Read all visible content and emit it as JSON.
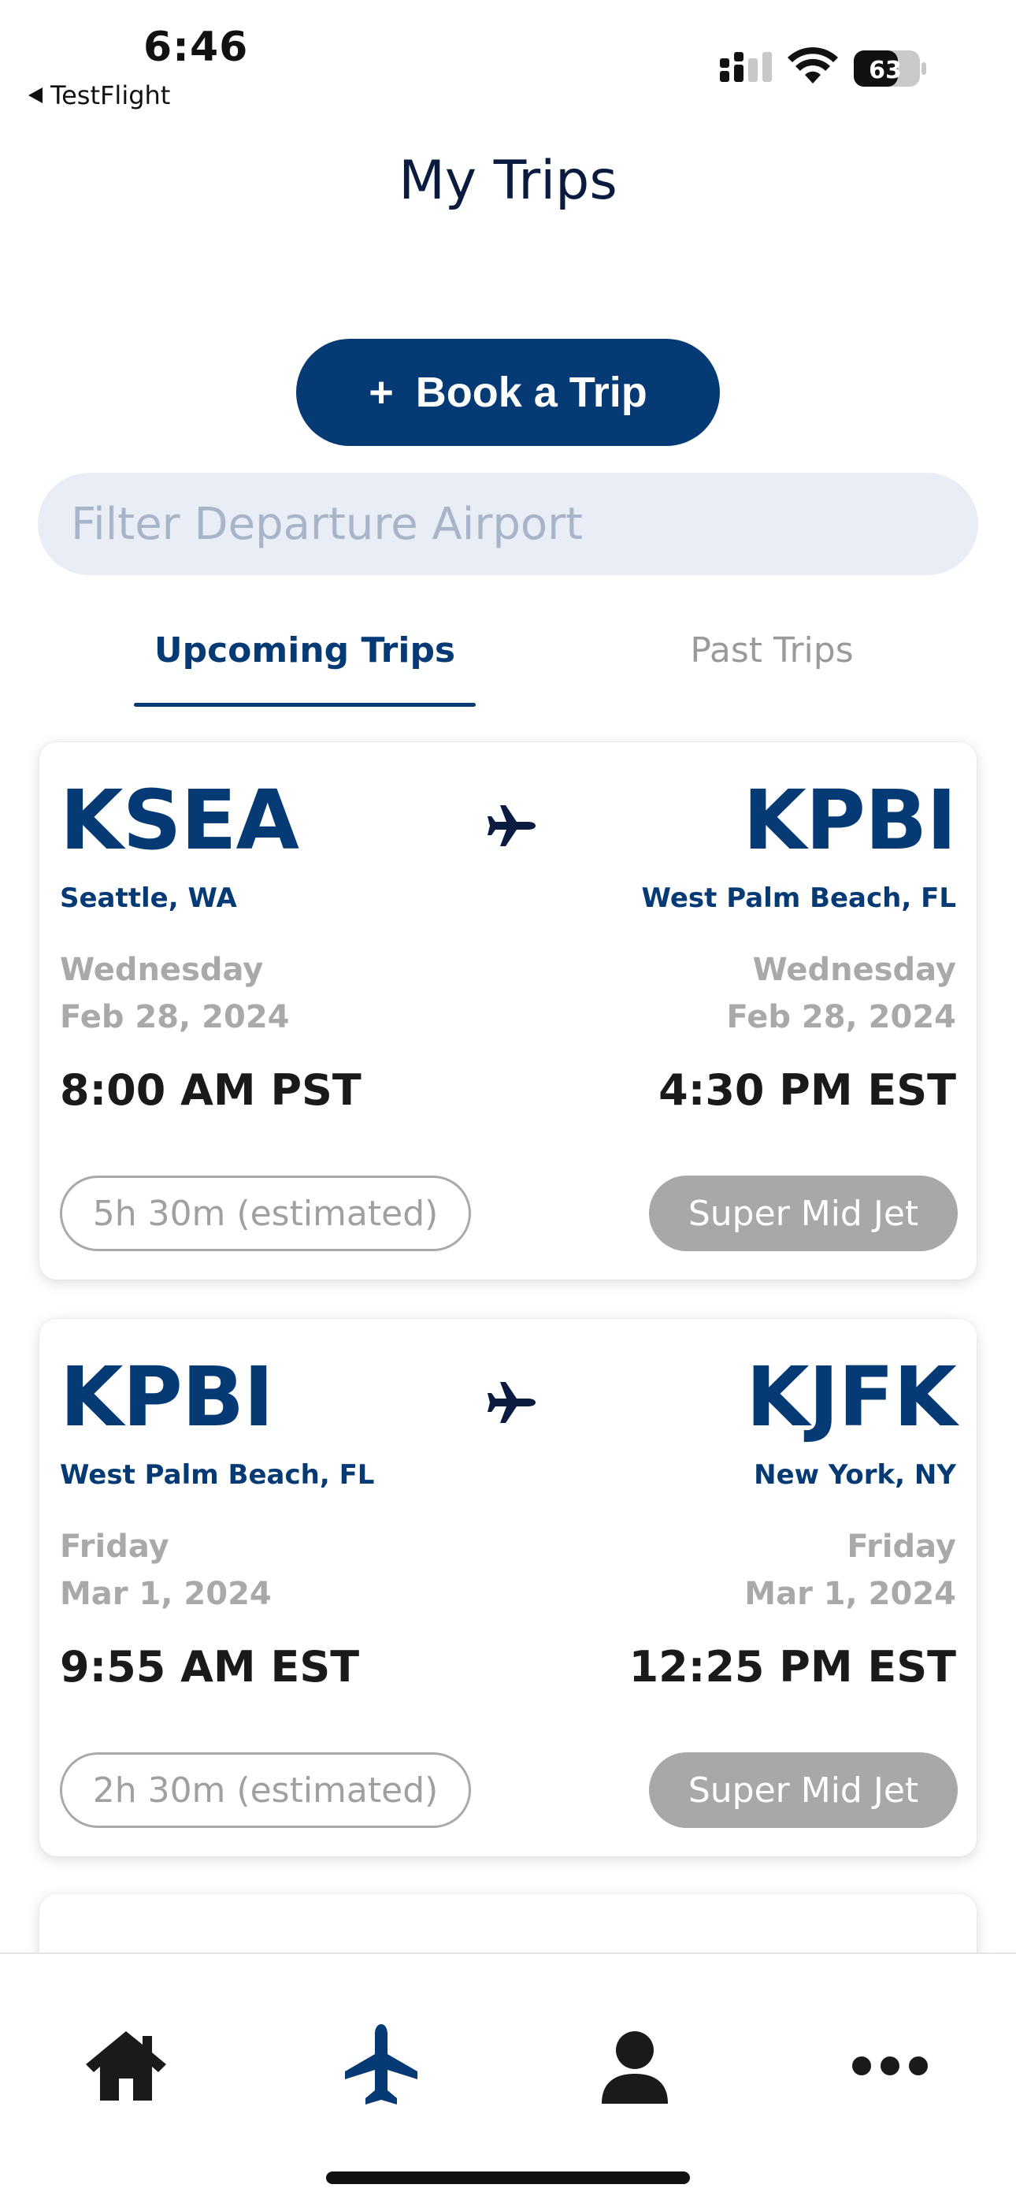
{
  "status_bar": {
    "time": "6:46",
    "back_label": "TestFlight",
    "battery": "63"
  },
  "header": {
    "title": "My Trips"
  },
  "book_button": {
    "plus": "+",
    "label": "Book a Trip"
  },
  "filter": {
    "placeholder": "Filter Departure Airport",
    "value": ""
  },
  "tabs": [
    {
      "label": "Upcoming Trips",
      "active": true
    },
    {
      "label": "Past Trips",
      "active": false
    }
  ],
  "trips": [
    {
      "from_code": "KSEA",
      "from_city": "Seattle, WA",
      "from_day": "Wednesday",
      "from_date": "Feb 28, 2024",
      "from_time": "8:00 AM PST",
      "to_code": "KPBI",
      "to_city": "West Palm Beach, FL",
      "to_day": "Wednesday",
      "to_date": "Feb 28, 2024",
      "to_time": "4:30 PM EST",
      "duration": "5h 30m (estimated)",
      "aircraft": "Super Mid Jet"
    },
    {
      "from_code": "KPBI",
      "from_city": "West Palm Beach, FL",
      "from_day": "Friday",
      "from_date": "Mar 1, 2024",
      "from_time": "9:55 AM EST",
      "to_code": "KJFK",
      "to_city": "New York, NY",
      "to_day": "Friday",
      "to_date": "Mar 1, 2024",
      "to_time": "12:25 PM EST",
      "duration": "2h 30m (estimated)",
      "aircraft": "Super Mid Jet"
    }
  ],
  "colors": {
    "brand": "#053a75",
    "title": "#0b1b3f",
    "muted": "#a9a9a9",
    "filter_bg": "#e9edf6"
  },
  "nav": {
    "items": [
      {
        "icon": "home-icon",
        "active": false
      },
      {
        "icon": "airplane-icon",
        "active": true
      },
      {
        "icon": "user-icon",
        "active": false
      },
      {
        "icon": "more-icon",
        "active": false
      }
    ]
  }
}
